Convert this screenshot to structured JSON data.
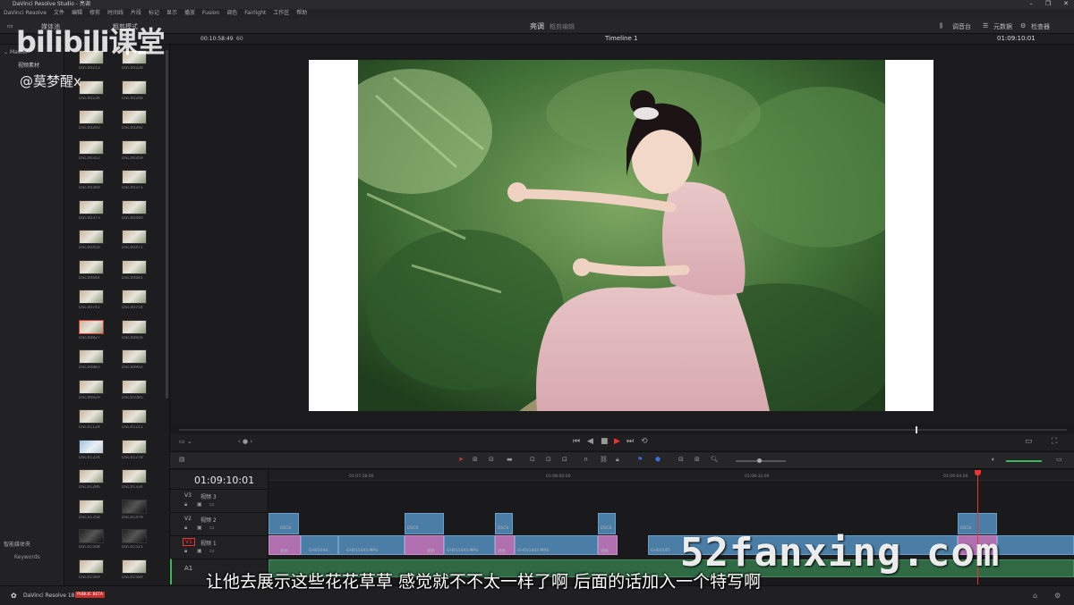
{
  "window": {
    "title": "DaVinci Resolve Studio - 亮调",
    "controls": [
      "–",
      "❐",
      "✕"
    ]
  },
  "menu": [
    "DaVinci Resolve",
    "文件",
    "编辑",
    "修剪",
    "时间线",
    "片段",
    "标记",
    "显示",
    "播放",
    "Fusion",
    "调色",
    "Fairlight",
    "工作区",
    "帮助"
  ],
  "toolbar": {
    "media_label": "媒体池",
    "project_name": "亮调",
    "edit_mode": "粗剪模式",
    "timeline_zoom_label": "调音台",
    "metadata_label": "元数据",
    "inspector_label": "检查器"
  },
  "subbar": {
    "timecode": "00:10:58:49",
    "fps": "60",
    "timeline_name": "Timeline 1",
    "current_tc": "01:09:10:01"
  },
  "leftpanel": {
    "bin_root": "Master",
    "bin_child": "视频素材",
    "smart_bins_label": "智能媒体夹",
    "keywords_label": "Keywords"
  },
  "media_clips": [
    [
      "DSC00213",
      "DSC00228"
    ],
    [
      "DSC00236",
      "DSC00248"
    ],
    [
      "DSC00283",
      "DSC00292"
    ],
    [
      "DSC00312",
      "DSC00359"
    ],
    [
      "DSC00369",
      "DSC00371"
    ],
    [
      "DSC00373",
      "DSC00440"
    ],
    [
      "DSC00450",
      "DSC00471"
    ],
    [
      "DSC00664",
      "DSC00681"
    ],
    [
      "DSC00741",
      "DSC00754"
    ],
    [
      "DSC00827",
      "DSC00856"
    ],
    [
      "DSC00883",
      "DSC00902"
    ],
    [
      "DSC00929",
      "DSC01085"
    ],
    [
      "DSC01129",
      "DSC01211"
    ],
    [
      "DSC01224",
      "DSC01278"
    ],
    [
      "DSC01286",
      "DSC01334"
    ],
    [
      "DSC01358",
      "DSC01479"
    ],
    [
      "DSC01508",
      "DSC01521"
    ],
    [
      "DSC01569",
      "DSC01589"
    ]
  ],
  "timeline": {
    "timecode": "01:09:10:01",
    "ruler": [
      "01:07:28:00",
      "01:08:00:00",
      "01:08:32:00",
      "01:09:04:00"
    ],
    "tracks": [
      {
        "id": "V3",
        "name": "视频 3"
      },
      {
        "id": "V2",
        "name": "视频 2"
      },
      {
        "id": "V1",
        "name": "视频 1"
      },
      {
        "id": "A1",
        "name": ""
      }
    ],
    "clip_labels": {
      "v2": "DSC0",
      "v1_a": "GH01044..",
      "v1_b": "GH011443.MP4",
      "v1_c": "GH011443.MP4",
      "v1_d": "GH011443.MP4",
      "v1_e": "GH01045",
      "pink": "调色"
    }
  },
  "bottombar": {
    "app_name": "DaVinci Resolve 18",
    "badge": "PUBLIC BETA"
  },
  "overlays": {
    "logo": "bilibili课堂",
    "user": "@莫梦醒x",
    "site": "52fanxing.com",
    "subtitle": "让他去展示这些花花草草 感觉就不不太一样了啊 后面的话加入一个特写啊"
  },
  "colors": {
    "accent_red": "#e03333",
    "clip_blue": "#4a7ea6",
    "clip_pink": "#b070b0",
    "audio_green": "#2f6a44"
  }
}
